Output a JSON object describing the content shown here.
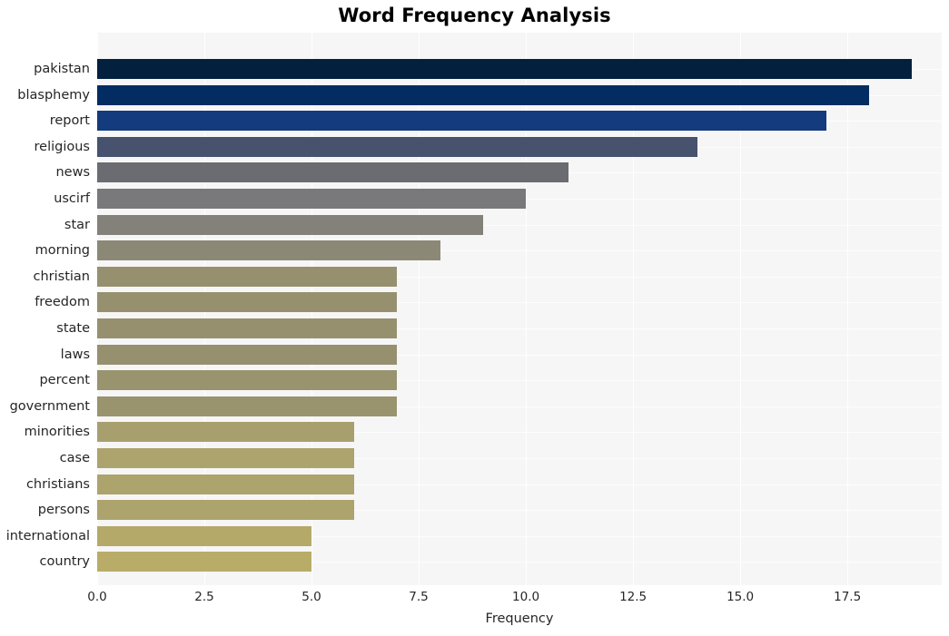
{
  "chart_data": {
    "type": "bar",
    "orientation": "horizontal",
    "title": "Word Frequency Analysis",
    "xlabel": "Frequency",
    "ylabel": "",
    "categories": [
      "pakistan",
      "blasphemy",
      "report",
      "religious",
      "news",
      "uscirf",
      "star",
      "morning",
      "christian",
      "freedom",
      "state",
      "laws",
      "percent",
      "government",
      "minorities",
      "case",
      "christians",
      "persons",
      "international",
      "country"
    ],
    "values": [
      19,
      18,
      17,
      14,
      11,
      10,
      9,
      8,
      7,
      7,
      7,
      7,
      7,
      7,
      6,
      6,
      6,
      6,
      5,
      5
    ],
    "bar_colors": [
      "#03203f",
      "#032d62",
      "#133b7d",
      "#46526e",
      "#6b6b72",
      "#79787a",
      "#838179",
      "#8c8876",
      "#96906f",
      "#96906f",
      "#96906f",
      "#96906f",
      "#99936e",
      "#99936e",
      "#a89f6e",
      "#ada36d",
      "#ada36d",
      "#ada36d",
      "#b5a96a",
      "#b8ac68"
    ],
    "xlim": [
      0,
      19.7
    ],
    "xticks": [
      0.0,
      2.5,
      5.0,
      7.5,
      10.0,
      12.5,
      15.0,
      17.5
    ],
    "xtick_labels": [
      "0.0",
      "2.5",
      "5.0",
      "7.5",
      "10.0",
      "12.5",
      "15.0",
      "17.5"
    ],
    "grid": true,
    "grid_color": "#ffffff",
    "plot_background": "#f6f6f7",
    "figure_background": "#ffffff",
    "legend": null
  }
}
